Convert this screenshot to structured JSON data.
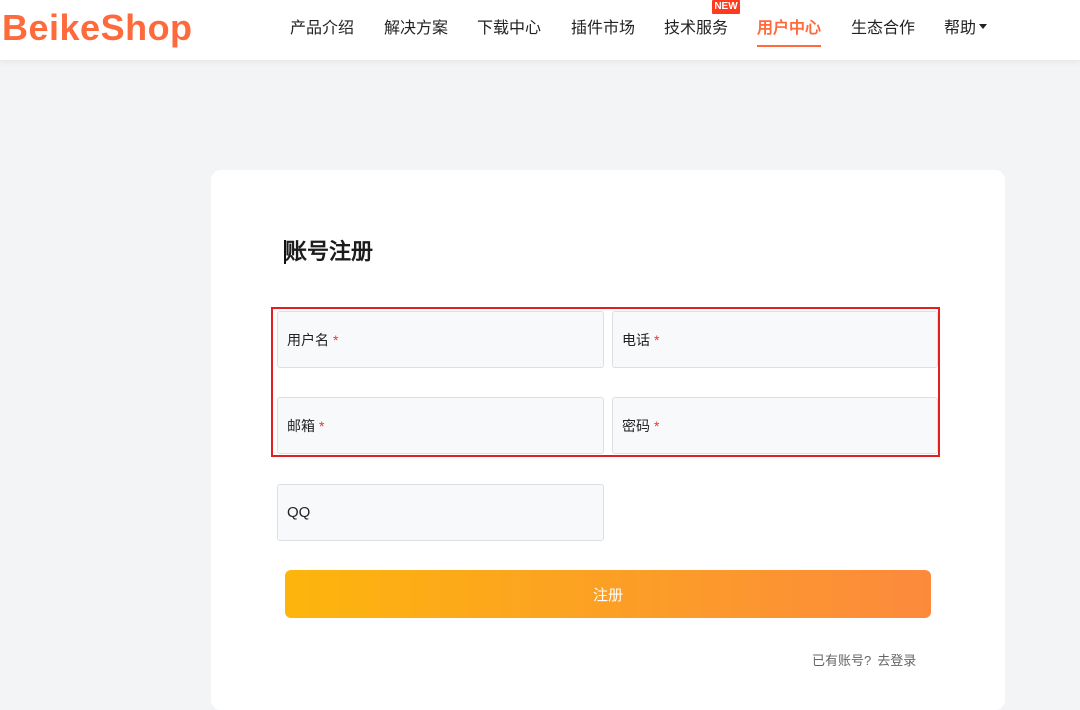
{
  "brand": {
    "logo_text": "BeikeShop",
    "accent_color": "#ff6a3d"
  },
  "nav": {
    "items": [
      {
        "label": "产品介绍"
      },
      {
        "label": "解决方案"
      },
      {
        "label": "下载中心"
      },
      {
        "label": "插件市场"
      },
      {
        "label": "技术服务",
        "badge": "NEW"
      },
      {
        "label": "用户中心",
        "active": true
      },
      {
        "label": "生态合作"
      },
      {
        "label": "帮助",
        "has_dropdown": true
      }
    ]
  },
  "form": {
    "title": "账号注册",
    "fields": {
      "username": {
        "label": "用户名",
        "required_mark": "*"
      },
      "phone": {
        "label": "电话",
        "required_mark": "*"
      },
      "email": {
        "label": "邮箱",
        "required_mark": "*"
      },
      "password": {
        "label": "密码",
        "required_mark": "*"
      },
      "qq": {
        "label": "QQ"
      }
    },
    "submit_label": "注册",
    "login_prompt": "已有账号?",
    "login_link": "去登录"
  },
  "colors": {
    "highlight_border": "#e41e1e",
    "button_gradient_start": "#fdb50c",
    "button_gradient_end": "#fc8a3d",
    "required_star": "#e53935"
  }
}
